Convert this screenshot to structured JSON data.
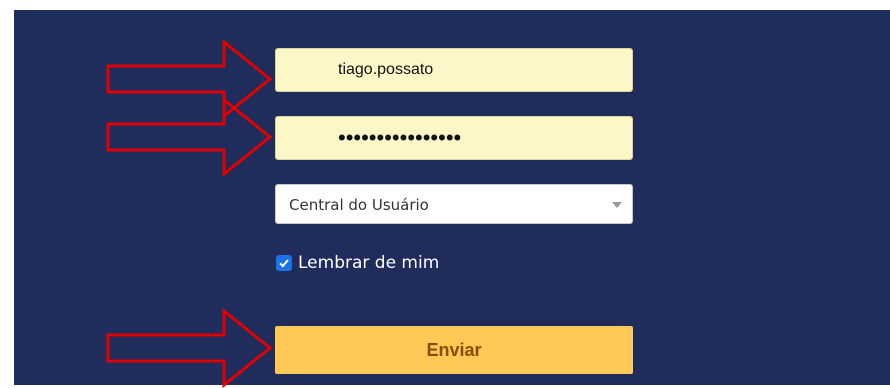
{
  "login": {
    "username_value": "tiago.possato",
    "password_value": "••••••••••••••••",
    "profile_select_value": "Central do Usuário",
    "remember_label": "Lembrar de mim",
    "remember_checked": true,
    "submit_label": "Enviar"
  },
  "annotations": {
    "arrow_color": "#e10000",
    "arrow_targets": [
      "username-field",
      "password-field",
      "submit-button"
    ]
  },
  "colors": {
    "background": "#1f2c5c",
    "input_fill": "#fdf6c6",
    "submit_fill": "#ffc857",
    "submit_text": "#8a4b00",
    "checkbox": "#1a73e8"
  },
  "icons": {
    "annotation": "right-arrow-icon",
    "dropdown": "chevron-down-icon",
    "checkbox": "checkmark-icon"
  }
}
